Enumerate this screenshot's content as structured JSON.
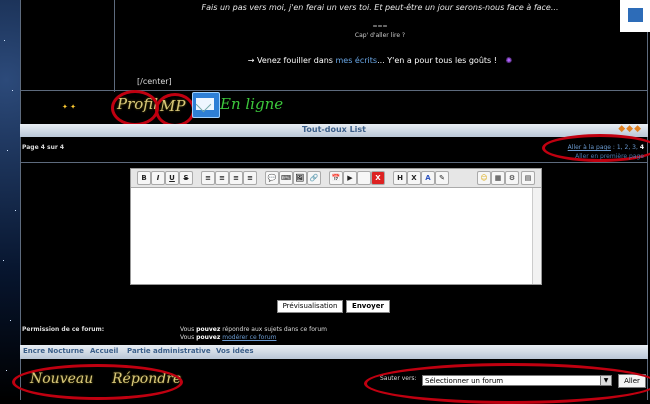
{
  "post": {
    "line1": "Fais un pas vers moi, j'en ferai un vers toi. Et peut-être un jour serons-nous face à face...",
    "separator": "===",
    "line2": "Cap' d'aller lire ?",
    "line3_prefix": "→ Venez fouiller dans ",
    "line3_link": "mes écrits",
    "line3_suffix": "... Y'en a pour tous les goûts !",
    "center_tag": "[/center]"
  },
  "signature": {
    "profil": "Profil",
    "mp": "MP",
    "en_ligne": "En ligne",
    "icons": [
      "profil-icon",
      "mp-icon",
      "mail-icon",
      "online-icon"
    ]
  },
  "topic_bar": {
    "title": "Tout-doux List",
    "arrows": "◆◆◆"
  },
  "pagination": {
    "info": "Page 4 sur 4",
    "goto_label": "Aller à la page",
    "pages": [
      "1",
      "2",
      "3",
      "4"
    ],
    "current": "4",
    "goto_line2": "Aller en première page"
  },
  "editor": {
    "toolbar": [
      "B",
      "I",
      "U",
      "S",
      "≡",
      "≡",
      "≡",
      "≡",
      "💬",
      "⌨",
      "🖼",
      "🔗",
      "📅",
      "▶",
      "H",
      "X",
      "A",
      "✎",
      "☺",
      "▦",
      "⚙",
      "▤"
    ]
  },
  "buttons": {
    "preview": "Prévisualisation",
    "send": "Envoyer"
  },
  "permissions": {
    "label": "Permission de ce forum:",
    "line1_prefix": "Vous ",
    "line1_strong": "pouvez",
    "line1_suffix": " répondre aux sujets dans ce forum",
    "line2_prefix": "Vous ",
    "line2_strong": "pouvez",
    "line2_link": "modérer ce forum"
  },
  "nav": [
    "Encre Nocturne",
    "Accueil",
    "Partie administrative",
    "Vos idées"
  ],
  "actions": {
    "nouveau": "Nouveau",
    "repondre": "Répondre"
  },
  "jump": {
    "label": "Sauter vers:",
    "selected": "Sélectionner un forum",
    "go": "Aller"
  },
  "colors": {
    "annotation_red": "#c00010",
    "bar_text": "#3b5f8a",
    "online_green": "#3cc83c"
  }
}
